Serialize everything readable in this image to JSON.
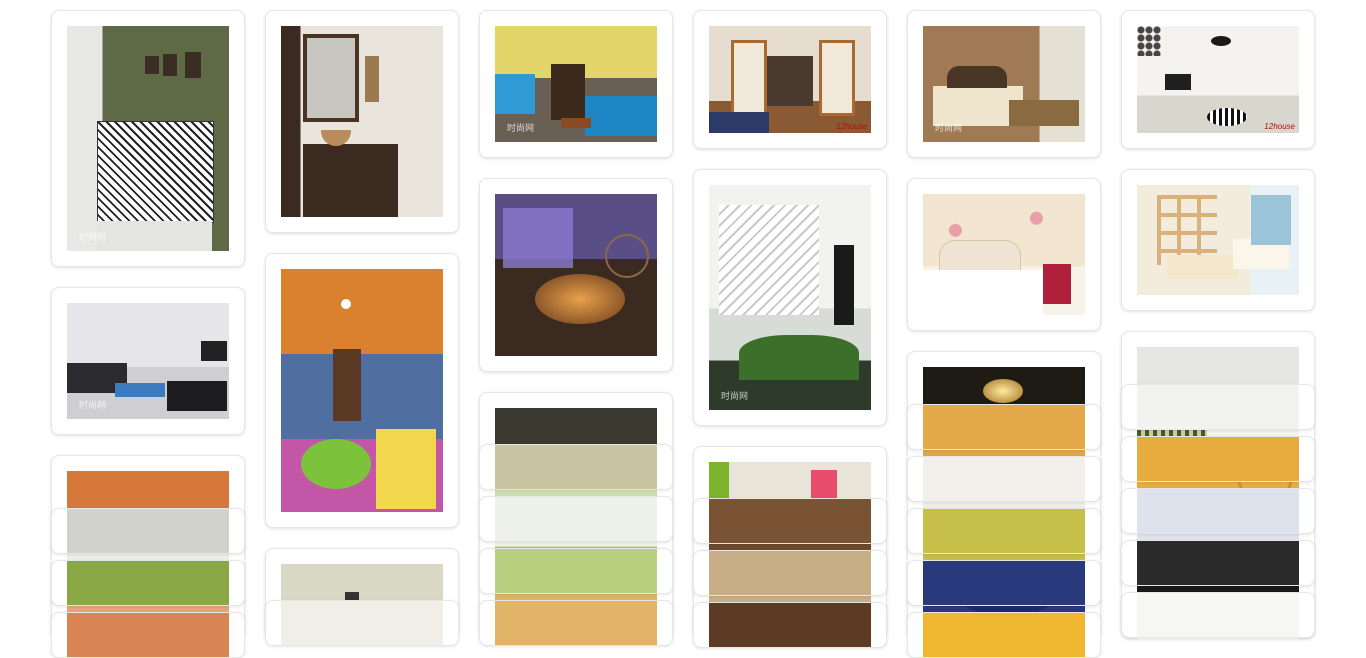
{
  "gallery": {
    "watermarks": {
      "site": "时尚网",
      "brand": "12house"
    },
    "photos": [
      {
        "subject": "green wall cabinet"
      },
      {
        "subject": "bathroom vanity"
      },
      {
        "subject": "yellow living room"
      },
      {
        "subject": "bedroom with french doors"
      },
      {
        "subject": "brown bedroom"
      },
      {
        "subject": "white living room"
      },
      {
        "subject": "grey living room"
      },
      {
        "subject": "mosaic bathroom"
      },
      {
        "subject": "candle-lit tub"
      },
      {
        "subject": "glass staircase"
      },
      {
        "subject": "floral bedroom"
      },
      {
        "subject": "wood shelving room"
      }
    ]
  }
}
